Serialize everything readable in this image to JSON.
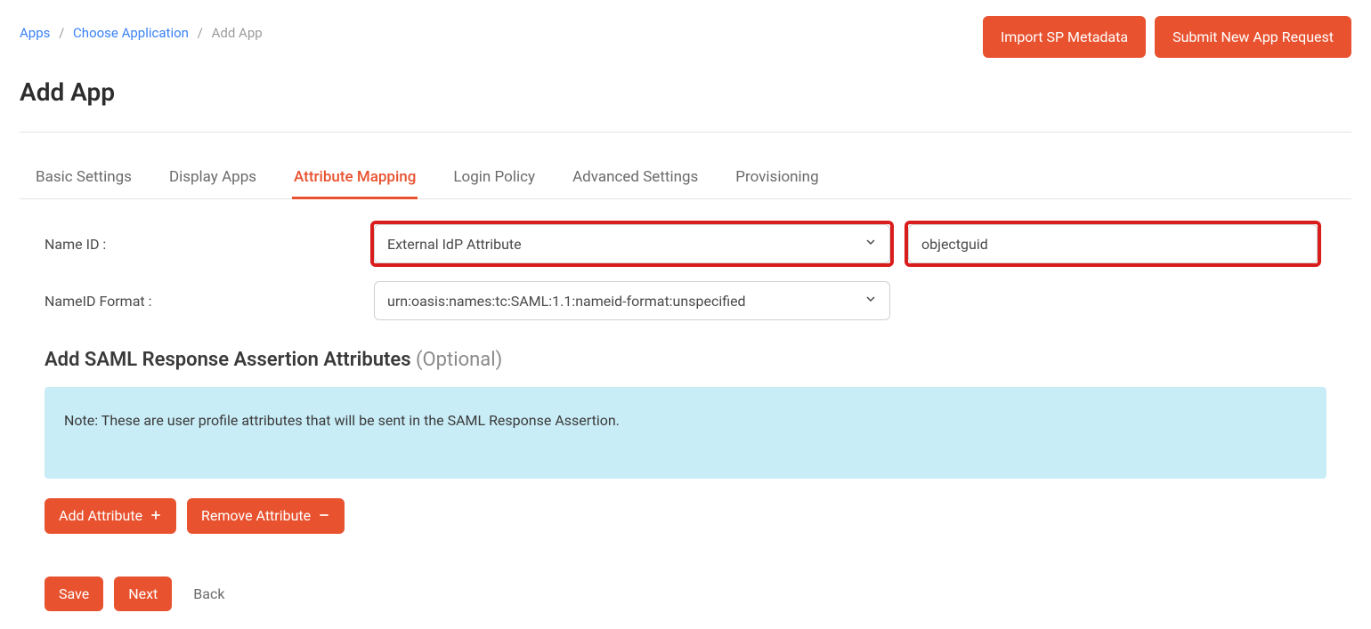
{
  "breadcrumb": {
    "items": [
      {
        "label": "Apps",
        "link": true
      },
      {
        "label": "Choose Application",
        "link": true
      },
      {
        "label": "Add App",
        "link": false
      }
    ]
  },
  "topButtons": {
    "import": "Import SP Metadata",
    "submitRequest": "Submit New App Request"
  },
  "pageTitle": "Add App",
  "tabs": [
    {
      "label": "Basic Settings",
      "active": false
    },
    {
      "label": "Display Apps",
      "active": false
    },
    {
      "label": "Attribute Mapping",
      "active": true
    },
    {
      "label": "Login Policy",
      "active": false
    },
    {
      "label": "Advanced Settings",
      "active": false
    },
    {
      "label": "Provisioning",
      "active": false
    }
  ],
  "form": {
    "nameIdLabel": "Name ID :",
    "nameIdSelectValue": "External IdP Attribute",
    "nameIdInputValue": "objectguid",
    "nameIdFormatLabel": "NameID Format :",
    "nameIdFormatValue": "urn:oasis:names:tc:SAML:1.1:nameid-format:unspecified"
  },
  "samlSection": {
    "heading": "Add SAML Response Assertion Attributes",
    "optional": "(Optional)",
    "note": "Note: These are user profile attributes that will be sent in the SAML Response Assertion.",
    "addAttribute": "Add Attribute",
    "removeAttribute": "Remove Attribute"
  },
  "bottom": {
    "save": "Save",
    "next": "Next",
    "back": "Back"
  },
  "colors": {
    "accent": "#e8522f",
    "highlight": "#d91c1c",
    "noteBg": "#c9edf7"
  }
}
